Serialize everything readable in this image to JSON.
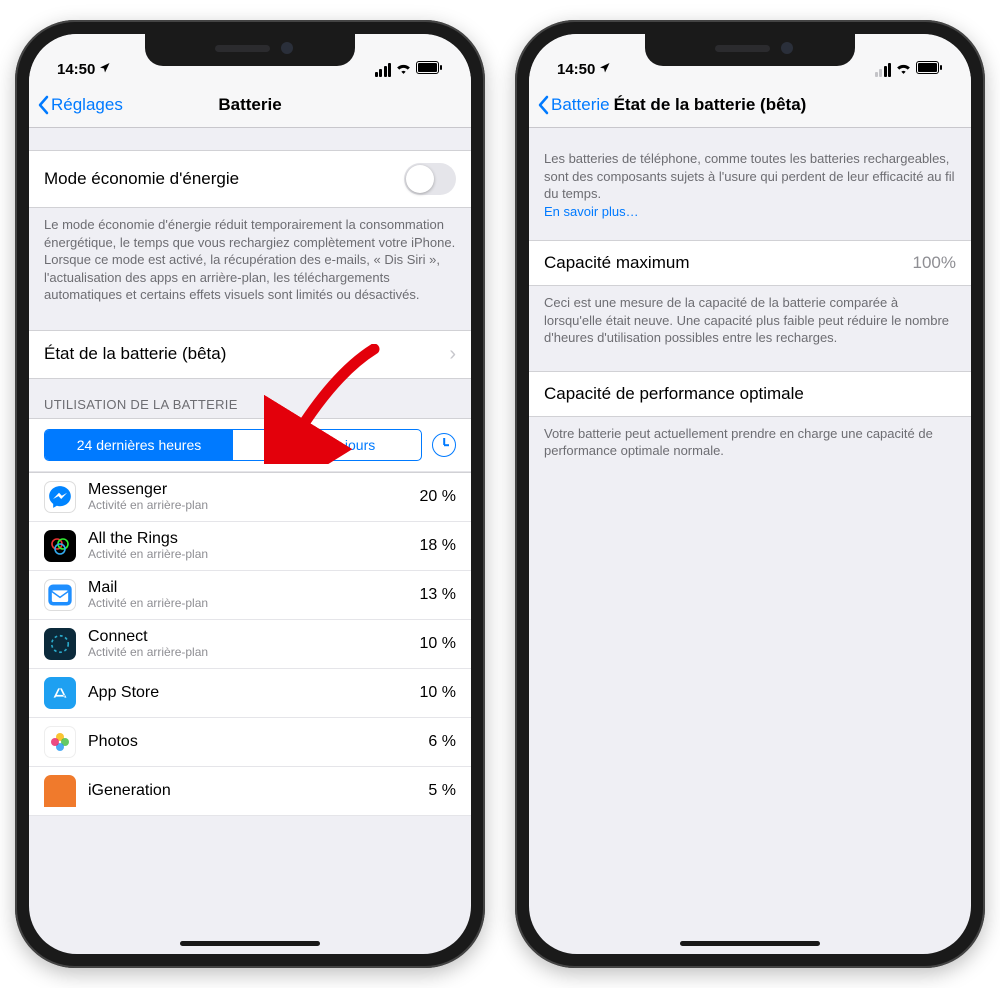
{
  "phone1": {
    "status": {
      "time": "14:50"
    },
    "nav": {
      "back": "Réglages",
      "title": "Batterie"
    },
    "lowpower": {
      "label": "Mode économie d'énergie",
      "footer": "Le mode économie d'énergie réduit temporairement la consommation énergétique, le temps que vous rechargiez complètement votre iPhone. Lorsque ce mode est activé, la récupération des e-mails, « Dis Siri », l'actualisation des apps en arrière-plan, les téléchargements automatiques et certains effets visuels sont limités ou désactivés."
    },
    "health": {
      "label": "État de la batterie (bêta)"
    },
    "usage": {
      "header": "UTILISATION DE LA BATTERIE",
      "seg_a": "24 dernières heures",
      "seg_b": "7 derniers jours",
      "sub_bg": "Activité en arrière-plan",
      "apps": [
        {
          "name": "Messenger",
          "sub": "Activité en arrière-plan",
          "pct": "20 %",
          "cls": "ic-messenger"
        },
        {
          "name": "All the Rings",
          "sub": "Activité en arrière-plan",
          "pct": "18 %",
          "cls": "ic-rings"
        },
        {
          "name": "Mail",
          "sub": "Activité en arrière-plan",
          "pct": "13 %",
          "cls": "ic-mail"
        },
        {
          "name": "Connect",
          "sub": "Activité en arrière-plan",
          "pct": "10 %",
          "cls": "ic-connect"
        },
        {
          "name": "App Store",
          "sub": "",
          "pct": "10 %",
          "cls": "ic-appstore"
        },
        {
          "name": "Photos",
          "sub": "",
          "pct": "6 %",
          "cls": "ic-photos"
        },
        {
          "name": "iGeneration",
          "sub": "",
          "pct": "5 %",
          "cls": "ic-igen"
        }
      ]
    }
  },
  "phone2": {
    "status": {
      "time": "14:50"
    },
    "nav": {
      "back": "Batterie",
      "title": "État de la batterie (bêta)"
    },
    "intro": "Les batteries de téléphone, comme toutes les batteries rechargeables, sont des composants sujets à l'usure qui perdent de leur efficacité au fil du temps.",
    "learn_more": "En savoir plus…",
    "capacity": {
      "label": "Capacité maximum",
      "value": "100%"
    },
    "capacity_footer": "Ceci est une mesure de la capacité de la batterie comparée à lorsqu'elle était neuve. Une capacité plus faible peut réduire le nombre d'heures d'utilisation possibles entre les recharges.",
    "perf": {
      "label": "Capacité de performance optimale"
    },
    "perf_footer": "Votre batterie peut actuellement prendre en charge une capacité de performance optimale normale."
  }
}
